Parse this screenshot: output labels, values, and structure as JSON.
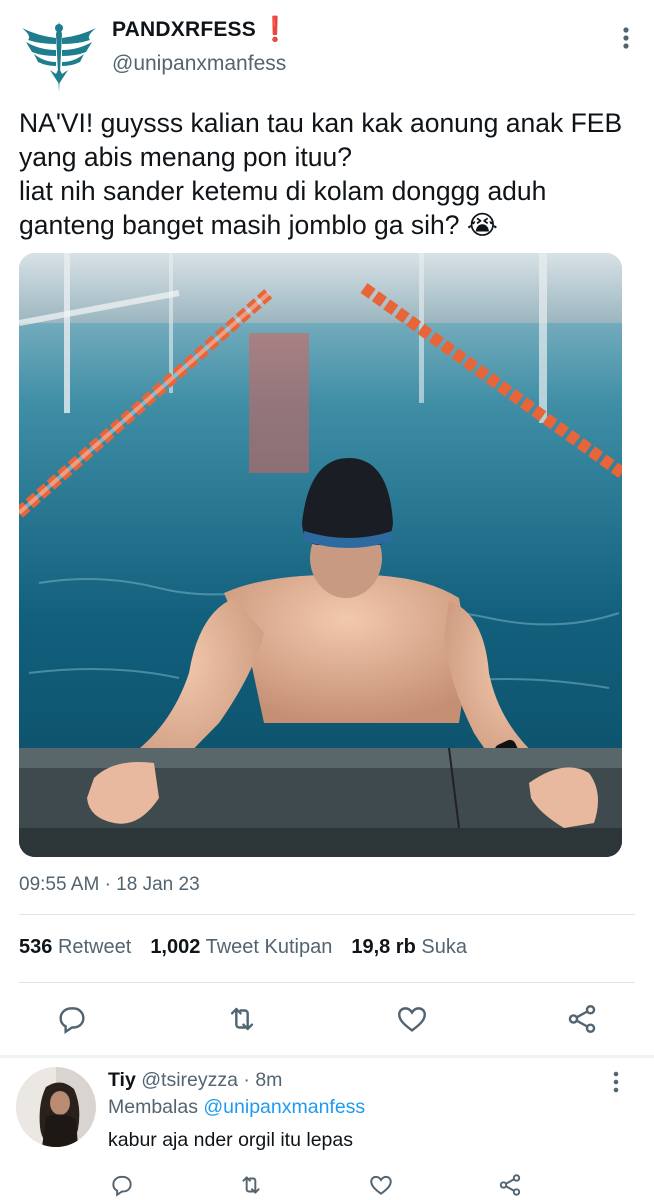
{
  "tweet": {
    "display_name": "PANDXRFESS",
    "name_badge": "❗",
    "handle": "@unipanxmanfess",
    "text": "NA'VI! guysss kalian tau kan kak aonung anak FEB yang abis menang pon ituu?\nliat nih sander ketemu di kolam donggg aduh ganteng banget masih jomblo ga sih? 😭",
    "media_icon": "swimmer-photo",
    "time": "09:55 AM",
    "dot": "·",
    "date": "18 Jan 23",
    "stats": {
      "retweets_count": "536",
      "retweets_label": "Retweet",
      "quotes_count": "1,002",
      "quotes_label": "Tweet Kutipan",
      "likes_count": "19,8 rb",
      "likes_label": "Suka"
    },
    "actions": [
      "reply-icon",
      "retweet-icon",
      "like-icon",
      "share-icon"
    ]
  },
  "reply": {
    "name": "Tiy",
    "handle": "@tsireyzza",
    "dot": "·",
    "age": "8m",
    "replying_label": "Membalas",
    "replying_to": "@unipanxmanfess",
    "text": "kabur aja nder orgil itu lepas"
  },
  "colors": {
    "text": "#0f1419",
    "muted": "#536471",
    "link": "#1d9bf0",
    "badge": "#e0245e",
    "divider": "#e1e5e8",
    "logo": "#1e7e8e"
  }
}
